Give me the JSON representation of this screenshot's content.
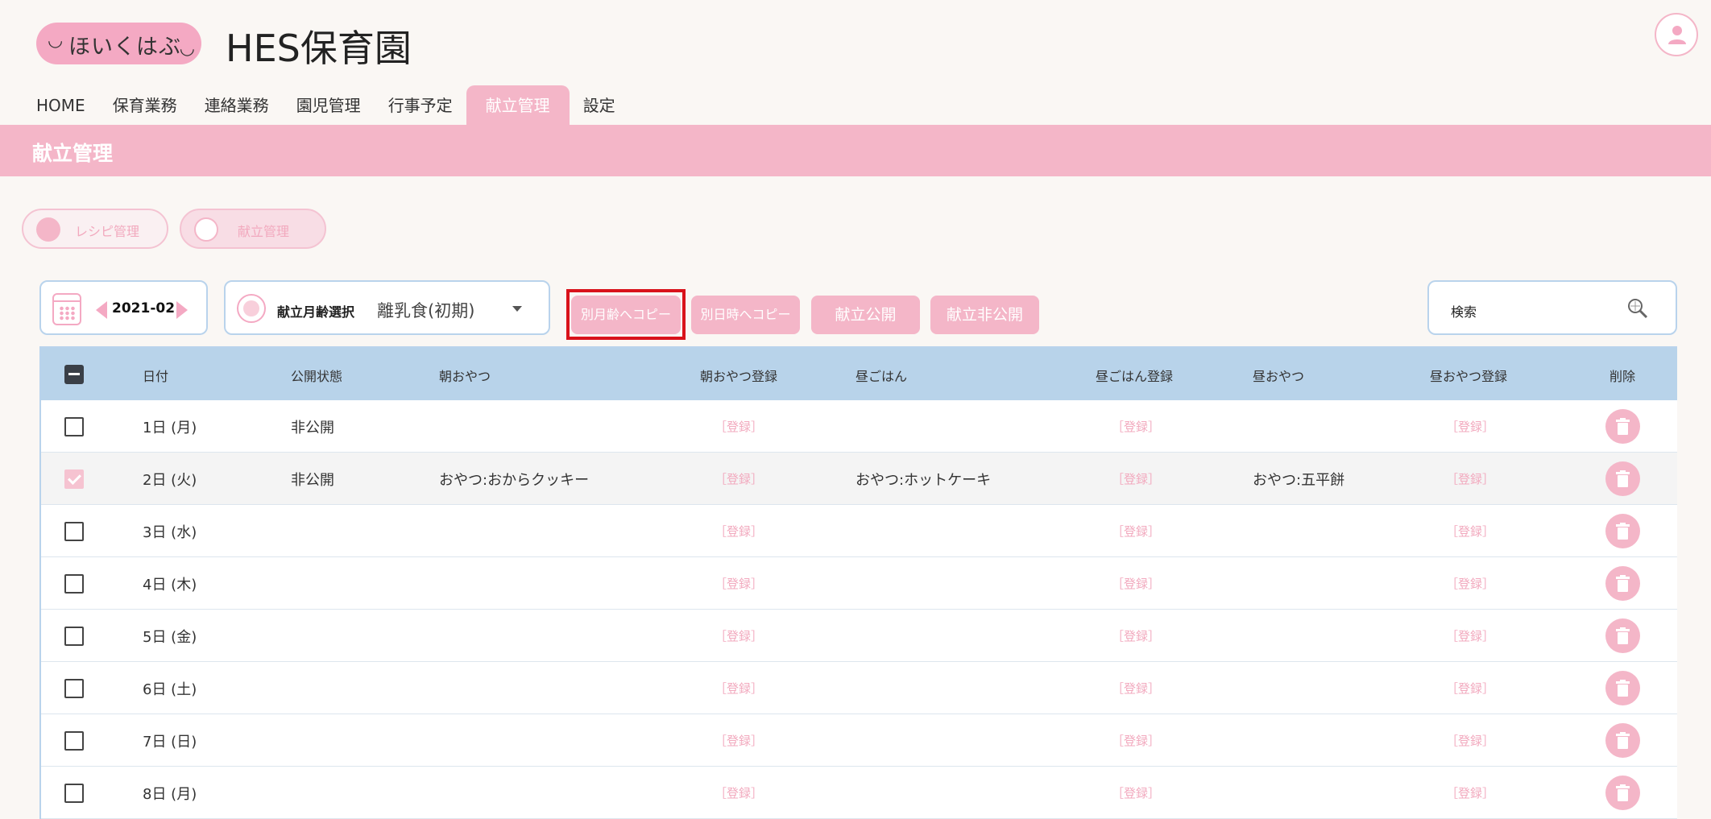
{
  "header": {
    "logo_text": "ほいくはぶ",
    "brand": "HES保育園"
  },
  "nav": [
    {
      "label": "HOME"
    },
    {
      "label": "保育業務"
    },
    {
      "label": "連絡業務"
    },
    {
      "label": "園児管理"
    },
    {
      "label": "行事予定"
    },
    {
      "label": "献立管理",
      "active": true
    },
    {
      "label": "設定"
    }
  ],
  "page_title": "献立管理",
  "subtabs": [
    {
      "label": "レシピ管理"
    },
    {
      "label": "献立管理",
      "active": true
    }
  ],
  "toolbar": {
    "month": "2021-02",
    "age_label": "献立月齢選択",
    "age_value": "離乳食(初期)",
    "copy_month_label": "別月齢へコピー",
    "copy_date_label": "別日時へコピー",
    "publish_label": "献立公開",
    "unpublish_label": "献立非公開",
    "search_label": "検索"
  },
  "table": {
    "headers": {
      "date": "日付",
      "status": "公開状態",
      "morning_snack": "朝おやつ",
      "morning_snack_reg": "朝おやつ登録",
      "lunch": "昼ごはん",
      "lunch_reg": "昼ごはん登録",
      "afternoon_snack": "昼おやつ",
      "afternoon_snack_reg": "昼おやつ登録",
      "delete": "削除"
    },
    "register_label": "［登録］",
    "rows": [
      {
        "date": "1日 (月)",
        "status": "非公開",
        "morning_snack": "",
        "lunch": "",
        "afternoon_snack": "",
        "checked": false
      },
      {
        "date": "2日 (火)",
        "status": "非公開",
        "morning_snack": "おやつ:おからクッキー",
        "lunch": "おやつ:ホットケーキ",
        "afternoon_snack": "おやつ:五平餅",
        "checked": true
      },
      {
        "date": "3日 (水)",
        "status": "",
        "morning_snack": "",
        "lunch": "",
        "afternoon_snack": "",
        "checked": false
      },
      {
        "date": "4日 (木)",
        "status": "",
        "morning_snack": "",
        "lunch": "",
        "afternoon_snack": "",
        "checked": false
      },
      {
        "date": "5日 (金)",
        "status": "",
        "morning_snack": "",
        "lunch": "",
        "afternoon_snack": "",
        "checked": false
      },
      {
        "date": "6日 (土)",
        "status": "",
        "morning_snack": "",
        "lunch": "",
        "afternoon_snack": "",
        "checked": false
      },
      {
        "date": "7日 (日)",
        "status": "",
        "morning_snack": "",
        "lunch": "",
        "afternoon_snack": "",
        "checked": false
      },
      {
        "date": "8日 (月)",
        "status": "",
        "morning_snack": "",
        "lunch": "",
        "afternoon_snack": "",
        "checked": false
      }
    ]
  },
  "colors": {
    "accent_pink": "#f4b6c8",
    "header_blue": "#b8d3ea",
    "highlight_red": "#d9121b"
  }
}
